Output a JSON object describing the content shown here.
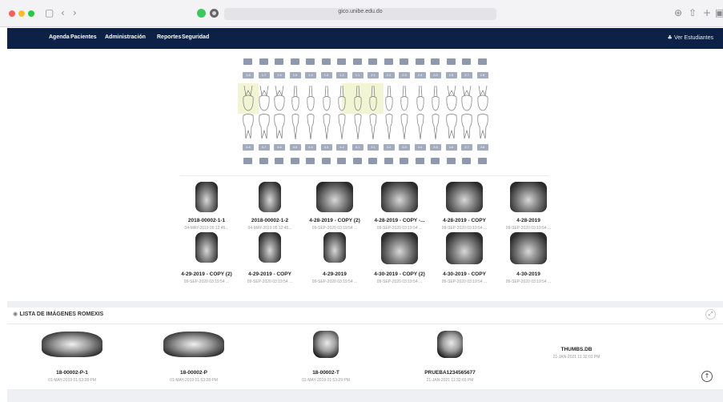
{
  "browser": {
    "url": "gico.unibe.edu.do"
  },
  "nav": {
    "items": [
      "Agenda",
      "Pacientes",
      "Administración",
      "Reportes",
      "Seguridad"
    ],
    "right_label": "Ver Estudiantes"
  },
  "odontogram": {
    "upper_numbers": [
      "1.8",
      "1.7",
      "1.6",
      "1.5",
      "1.4",
      "1.3",
      "1.2",
      "1.1",
      "2.1",
      "2.2",
      "2.3",
      "2.4",
      "2.5",
      "2.6",
      "2.7",
      "2.8"
    ],
    "lower_numbers": [
      "4.8",
      "4.7",
      "4.6",
      "4.5",
      "4.4",
      "4.3",
      "4.2",
      "4.1",
      "3.1",
      "3.2",
      "3.3",
      "3.4",
      "3.5",
      "3.6",
      "3.7",
      "3.8"
    ]
  },
  "images": [
    {
      "title": "2018-00002-1-1",
      "date": "04-MAY-2019 05:12:45..."
    },
    {
      "title": "2018-00002-1-2",
      "date": "04-MAY-2019 05:12:45..."
    },
    {
      "title": "4-28-2019 - COPY (2)",
      "date": "09-SEP-2020 03:19:54 ..."
    },
    {
      "title": "4-28-2019 - COPY -...",
      "date": "09-SEP-2020 03:19:54 ..."
    },
    {
      "title": "4-28-2019 - COPY",
      "date": "09-SEP-2020 03:19:54 ..."
    },
    {
      "title": "4-28-2019",
      "date": "09-SEP-2020 03:19:54 ..."
    },
    {
      "title": "4-29-2019 - COPY (2)",
      "date": "09-SEP-2020 03:19:54 ..."
    },
    {
      "title": "4-29-2019 - COPY",
      "date": "09-SEP-2020 03:19:54 ..."
    },
    {
      "title": "4-29-2019",
      "date": "09-SEP-2020 03:19:54 ..."
    },
    {
      "title": "4-30-2019 - COPY (2)",
      "date": "09-SEP-2020 03:19:54 ..."
    },
    {
      "title": "4-30-2019 - COPY",
      "date": "09-SEP-2020 03:19:54 ..."
    },
    {
      "title": "4-30-2019",
      "date": "09-SEP-2020 03:19:54 ..."
    }
  ],
  "romexis": {
    "header": "LISTA DE IMÁGENES ROMEXIS",
    "items": [
      {
        "title": "18-00002-P-1",
        "date": "01-MAY-2019 01:53:28 PM",
        "kind": "panoramic"
      },
      {
        "title": "18-00002-P",
        "date": "01-MAY-2019 01:53:28 PM",
        "kind": "panoramic"
      },
      {
        "title": "18-00002-T",
        "date": "01-MAY-2019 01:53:29 PM",
        "kind": "skull"
      },
      {
        "title": "PRUEBA1234565677",
        "date": "21-JAN-2021 11:32:03 PM",
        "kind": "skull"
      },
      {
        "title": "THUMBS.DB",
        "date": "21-JAN-2021 11:32:03 PM",
        "kind": "none"
      }
    ]
  },
  "colors": {
    "nav_bg": "#0c2145",
    "tooth_box": "#8e99ad",
    "highlight": "#f2f5d4"
  }
}
